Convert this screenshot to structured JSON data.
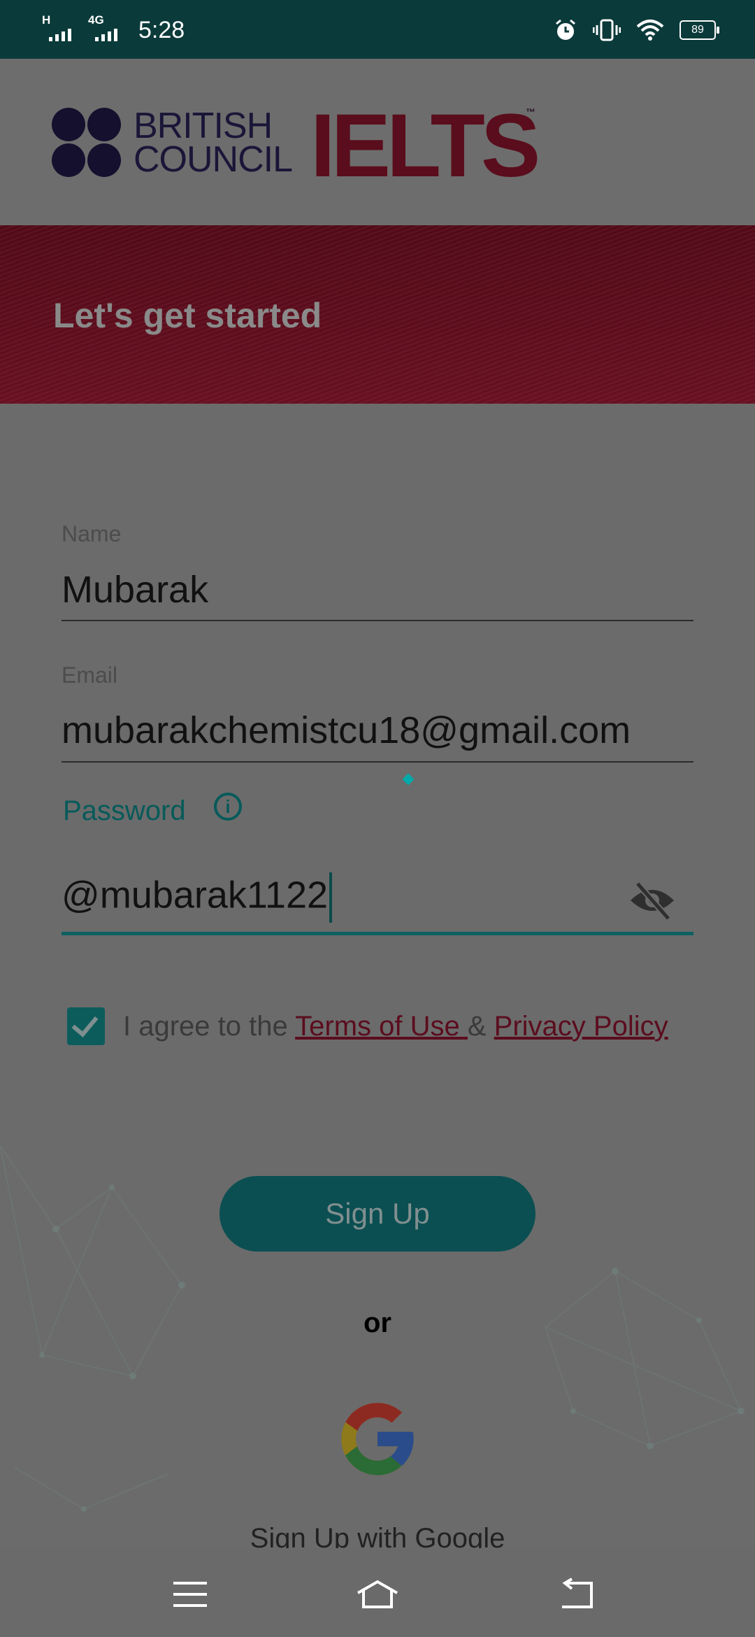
{
  "status_bar": {
    "signal1_label": "H",
    "signal2_label": "4G",
    "time": "5:28",
    "battery": "89"
  },
  "header": {
    "brand_line1": "BRITISH",
    "brand_line2": "COUNCIL",
    "product": "IELTS",
    "trademark": "™"
  },
  "banner": {
    "title": "Let's get started"
  },
  "form": {
    "name": {
      "label": "Name",
      "value": "Mubarak"
    },
    "email": {
      "label": "Email",
      "value": "mubarakchemistcu18@gmail.com"
    },
    "password": {
      "label": "Password",
      "value": "@mubarak1122",
      "info_icon": "info-icon",
      "toggle_icon": "eye-off-icon"
    },
    "agree": {
      "checked": true,
      "prefix": "I agree to the ",
      "terms": "Terms of Use ",
      "amp": "& ",
      "privacy": "Privacy Policy"
    }
  },
  "actions": {
    "signup": "Sign Up",
    "or": "or",
    "google_label": "Sign Up with Google"
  },
  "nav": {
    "menu_icon": "menu-icon",
    "home_icon": "home-icon",
    "back_icon": "back-icon"
  },
  "colors": {
    "accent": "#0d6161",
    "brand_red": "#5a0d1c"
  }
}
